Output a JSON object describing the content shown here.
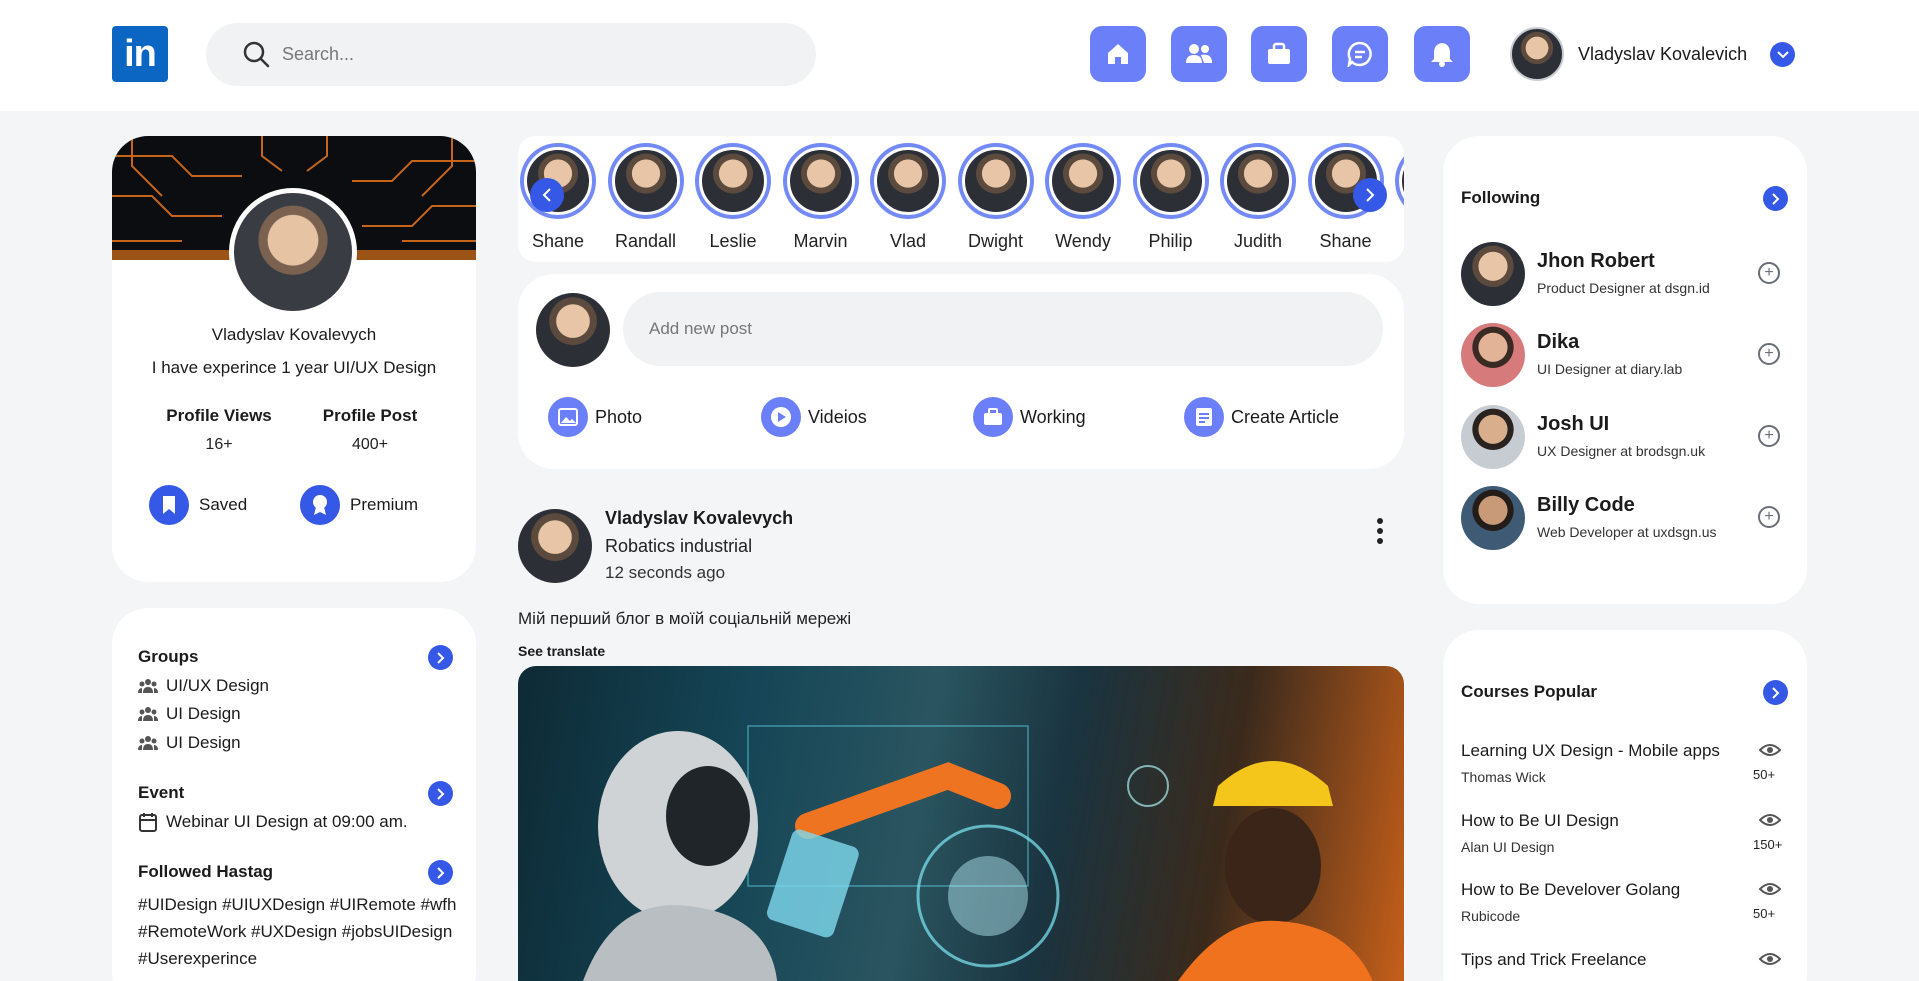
{
  "header": {
    "logo_text": "in",
    "search_placeholder": "Search...",
    "nav_icons": [
      "home-icon",
      "people-icon",
      "briefcase-icon",
      "message-icon",
      "bell-icon"
    ],
    "user_name": "Vladyslav Kovalevich"
  },
  "profile": {
    "name": "Vladyslav Kovalevych",
    "bio": "I have experince 1 year UI/UX Design",
    "stats": [
      {
        "label": "Profile Views",
        "value": "16+"
      },
      {
        "label": "Profile Post",
        "value": "400+"
      }
    ],
    "saved_label": "Saved",
    "premium_label": "Premium"
  },
  "sidebar": {
    "groups_title": "Groups",
    "groups": [
      "UI/UX Design",
      "UI Design",
      "UI Design"
    ],
    "event_title": "Event",
    "event": "Webinar UI Design at 09:00 am.",
    "hashtag_title": "Followed Hastag",
    "hashtags": "#UIDesign #UIUXDesign #UIRemote #wfh #RemoteWork #UXDesign #jobsUIDesign #Userexperince"
  },
  "stories": [
    "Shane",
    "Randall",
    "Leslie",
    "Marvin",
    "Vlad",
    "Dwight",
    "Wendy",
    "Philip",
    "Judith",
    "Shane"
  ],
  "composer": {
    "placeholder": "Add new post",
    "actions": [
      "Photo",
      "Videios",
      "Working",
      "Create Article"
    ]
  },
  "post": {
    "author": "Vladyslav Kovalevych",
    "subtitle": "Robatics industrial",
    "time": "12 seconds ago",
    "text": "Мій перший блог в моїй соціальній мережі",
    "translate": "See translate"
  },
  "following": {
    "title": "Following",
    "people": [
      {
        "name": "Jhon Robert",
        "role": "Product Designer at dsgn.id"
      },
      {
        "name": "Dika",
        "role": "UI Designer at diary.lab"
      },
      {
        "name": "Josh UI",
        "role": "UX Designer at brodsgn.uk"
      },
      {
        "name": "Billy Code",
        "role": "Web Developer at uxdsgn.us"
      }
    ]
  },
  "courses": {
    "title": "Courses Popular",
    "items": [
      {
        "title": "Learning UX Design - Mobile apps",
        "author": "Thomas Wick",
        "views": "50+"
      },
      {
        "title": "How to Be UI Design",
        "author": "Alan UI Design",
        "views": "150+"
      },
      {
        "title": "How to Be Develover Golang",
        "author": "Rubicode",
        "views": "50+"
      },
      {
        "title": "Tips and Trick Freelance",
        "author": "",
        "views": ""
      }
    ]
  },
  "colors": {
    "accent": "#3558e6",
    "nav_button": "#6b7ff8",
    "background": "#f4f5f7"
  }
}
